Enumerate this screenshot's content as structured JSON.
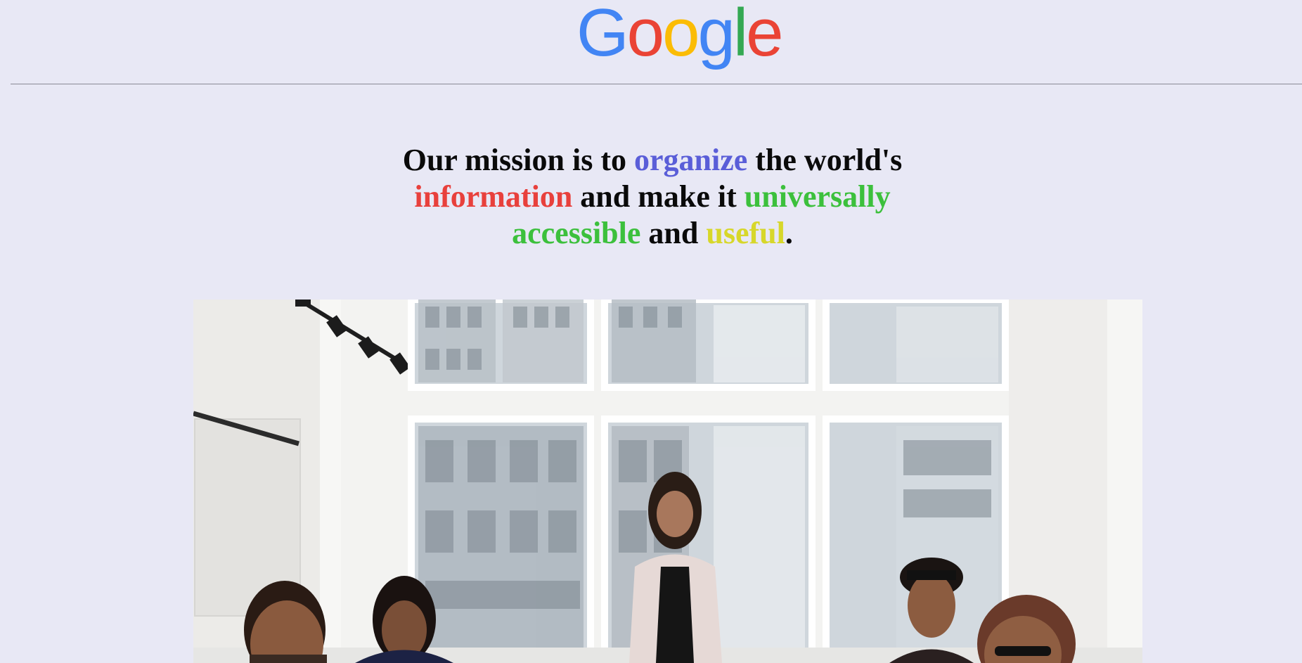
{
  "logo": {
    "letters": [
      "G",
      "o",
      "o",
      "g",
      "l",
      "e"
    ],
    "colors": [
      "#4285f4",
      "#ea4335",
      "#fbbc05",
      "#4285f4",
      "#34a853",
      "#ea4335"
    ]
  },
  "mission": {
    "part1": "Our mission is to ",
    "highlight1": "organize",
    "part2": " the world's ",
    "highlight2": "information",
    "part3": " and make it ",
    "highlight3": "universally",
    "part4": " ",
    "highlight4": "accessible",
    "part5": " and ",
    "highlight5": "useful",
    "part6": ".",
    "colors": {
      "organize": "#5a5ed8",
      "information": "#e8403c",
      "universally": "#3cc03c",
      "accessible": "#3cc03c",
      "useful": "#d7d72a"
    }
  },
  "hero_image": {
    "icon": "team-meeting-photo"
  }
}
